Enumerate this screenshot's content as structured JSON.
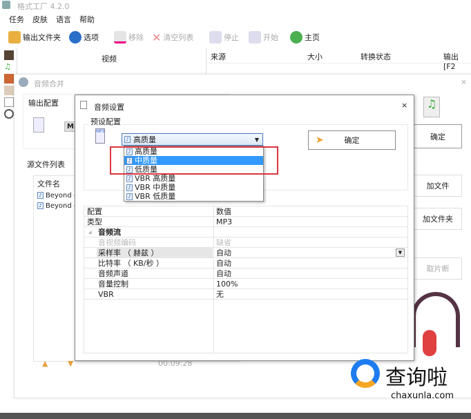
{
  "app": {
    "title": "格式工厂 4.2.0"
  },
  "menu": [
    "任务",
    "皮肤",
    "语言",
    "帮助"
  ],
  "toolbar": {
    "output_folder": "输出文件夹",
    "options": "选项",
    "remove": "移除",
    "clear_list": "清空列表",
    "stop": "停止",
    "start": "开始",
    "home": "主页"
  },
  "left_panel": {
    "video": "视频"
  },
  "task_table": {
    "headers": [
      "来源",
      "大小",
      "转换状态",
      "输出 [F2"
    ]
  },
  "merge_window": {
    "title": "音频合并",
    "output_config": "输出配置",
    "mp_label": "MP",
    "source_list": "源文件列表",
    "file_name_header": "文件名",
    "files": [
      "Beyond -",
      "Beyond -"
    ],
    "duration": "00:09:28",
    "ok": "确定",
    "add_file": "加文件",
    "add_folder": "加文件夹",
    "clip": "取片断"
  },
  "audio_settings": {
    "title": "音频设置",
    "preset_group": "预设配置",
    "preset_selected": "高质量",
    "preset_options": [
      "高质量",
      "中质量",
      "低质量",
      "VBR 高质量",
      "VBR 中质量",
      "VBR 低质量"
    ],
    "highlighted_option": 1,
    "ok": "确定",
    "props_header": [
      "配置",
      "数值"
    ],
    "props": [
      {
        "name": "类型",
        "value": "MP3",
        "style": "normal"
      },
      {
        "name": "音频流",
        "value": "",
        "style": "section"
      },
      {
        "name": "音视频编码",
        "value": "缺省",
        "style": "disabled"
      },
      {
        "name": "采样率 （ 赫兹 ）",
        "value": "自动",
        "style": "selected"
      },
      {
        "name": "比特率 （ KB/秒 ）",
        "value": "自动",
        "style": "normal"
      },
      {
        "name": "音频声道",
        "value": "自动",
        "style": "normal"
      },
      {
        "name": "音量控制",
        "value": "100%",
        "style": "normal"
      },
      {
        "name": "VBR",
        "value": "无",
        "style": "normal"
      }
    ]
  },
  "watermark": {
    "brand": "查询啦",
    "url": "chaxunla.com"
  },
  "colors": {
    "highlight": "#3399ff",
    "annotation_red": "#d9363e"
  }
}
